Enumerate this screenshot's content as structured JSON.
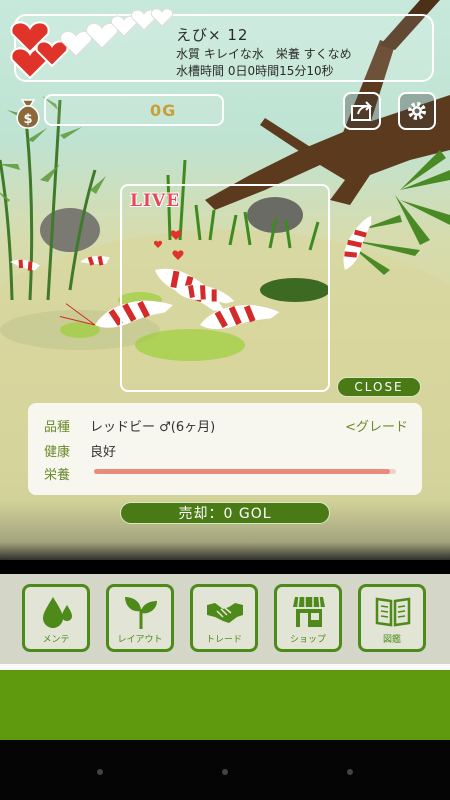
{
  "status": {
    "shrimp_count": "えび× 12",
    "water_line": "水質 キレイな水　栄養 すくなめ",
    "time_line": "水槽時間 0日0時間15分10秒",
    "hearts_filled": 3,
    "hearts_total": 8
  },
  "money": {
    "value": "0G"
  },
  "live": {
    "label": "LIVE",
    "close_label": "CLOSE"
  },
  "detail": {
    "breed_label": "品種",
    "breed_value": "レッドビー ♂(6ヶ月)",
    "grade_link": "<グレード",
    "health_label": "健康",
    "health_value": "良好",
    "nutrition_label": "栄養",
    "nutrition_level": 0.98
  },
  "sell": {
    "label": "売却：0 GOL"
  },
  "menu": {
    "maintenance": "メンテ",
    "layout": "レイアウト",
    "trade": "トレード",
    "shop": "ショップ",
    "encyclopedia": "図鑑"
  },
  "colors": {
    "accent_green": "#4e8a1a",
    "heart_red": "#e0342a",
    "live_red": "#e8475a"
  },
  "icons": [
    "heart-icon",
    "money-bag-icon",
    "share-icon",
    "gear-icon",
    "water-drops-icon",
    "sprout-icon",
    "handshake-icon",
    "shop-icon",
    "book-icon"
  ]
}
